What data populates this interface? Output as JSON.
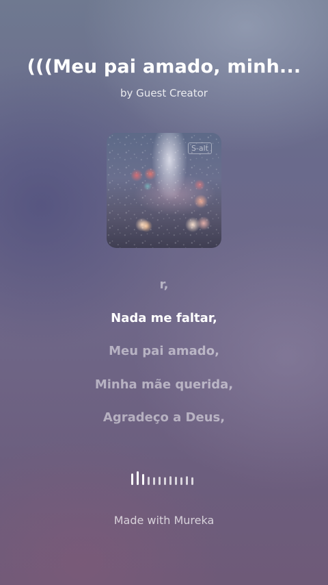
{
  "song": {
    "title": "(((Meu pai amado, minh...",
    "byline": "by Guest Creator"
  },
  "cover": {
    "watermark": "S-alt"
  },
  "lyrics": [
    {
      "text": "r,",
      "active": false
    },
    {
      "text": "Nada me faltar,",
      "active": true
    },
    {
      "text": "Meu pai amado,",
      "active": false
    },
    {
      "text": "Minha mãe querida,",
      "active": false
    },
    {
      "text": "Agradeço a Deus,",
      "active": false
    }
  ],
  "waveform": {
    "icon": "audio-waveform-icon",
    "levels": [
      0.8,
      1.0,
      0.75,
      0.5,
      0.45,
      0.5,
      0.45,
      0.55,
      0.5,
      0.45,
      0.55,
      0.45
    ],
    "bright_count": 3
  },
  "footer": {
    "made_with": "Made with Mureka"
  }
}
